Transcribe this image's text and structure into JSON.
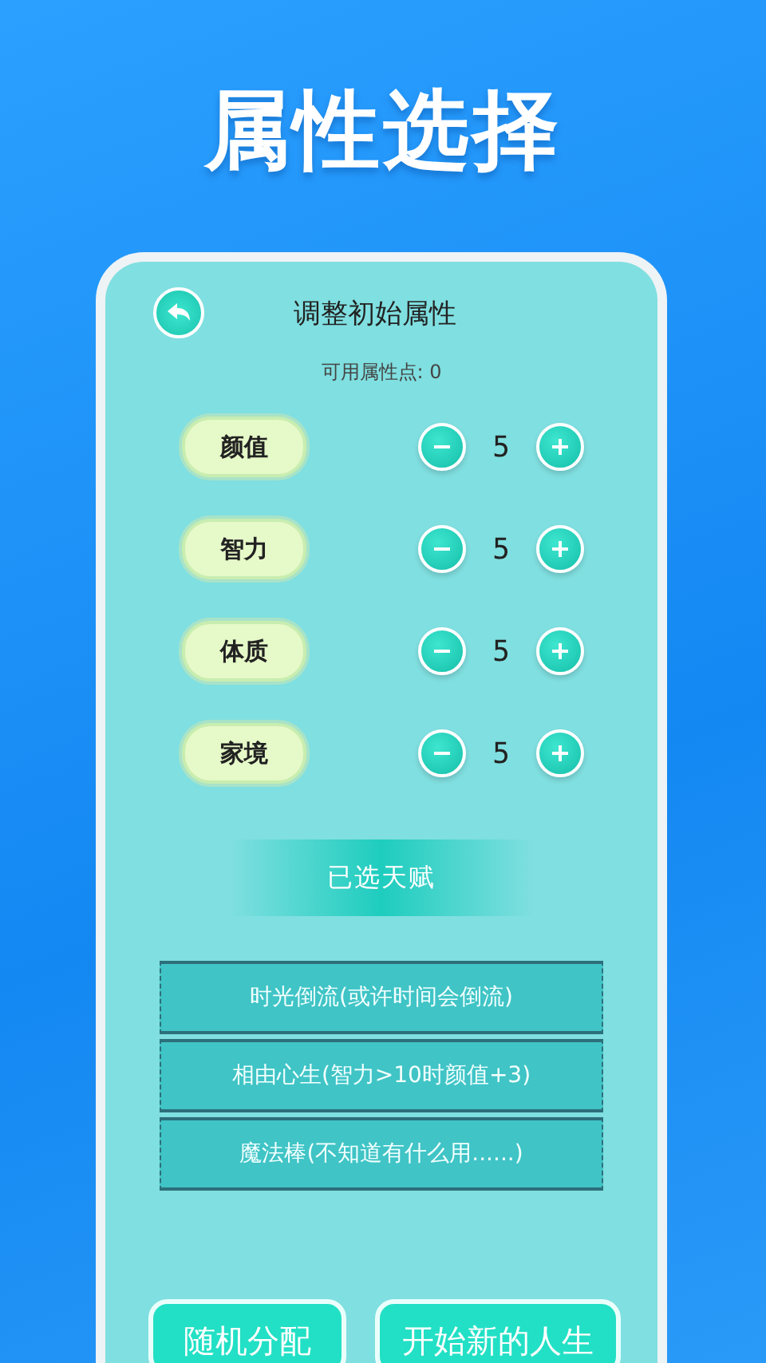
{
  "page_title": "属性选择",
  "panel": {
    "title": "调整初始属性",
    "points_label": "可用属性点: 0"
  },
  "attributes": [
    {
      "name": "颜值",
      "value": "5"
    },
    {
      "name": "智力",
      "value": "5"
    },
    {
      "name": "体质",
      "value": "5"
    },
    {
      "name": "家境",
      "value": "5"
    }
  ],
  "talents_heading": "已选天赋",
  "talents": [
    "时光倒流(或许时间会倒流)",
    "相由心生(智力>10时颜值+3)",
    "魔法棒(不知道有什么用......)"
  ],
  "buttons": [
    "随机分配",
    "开始新的人生"
  ]
}
